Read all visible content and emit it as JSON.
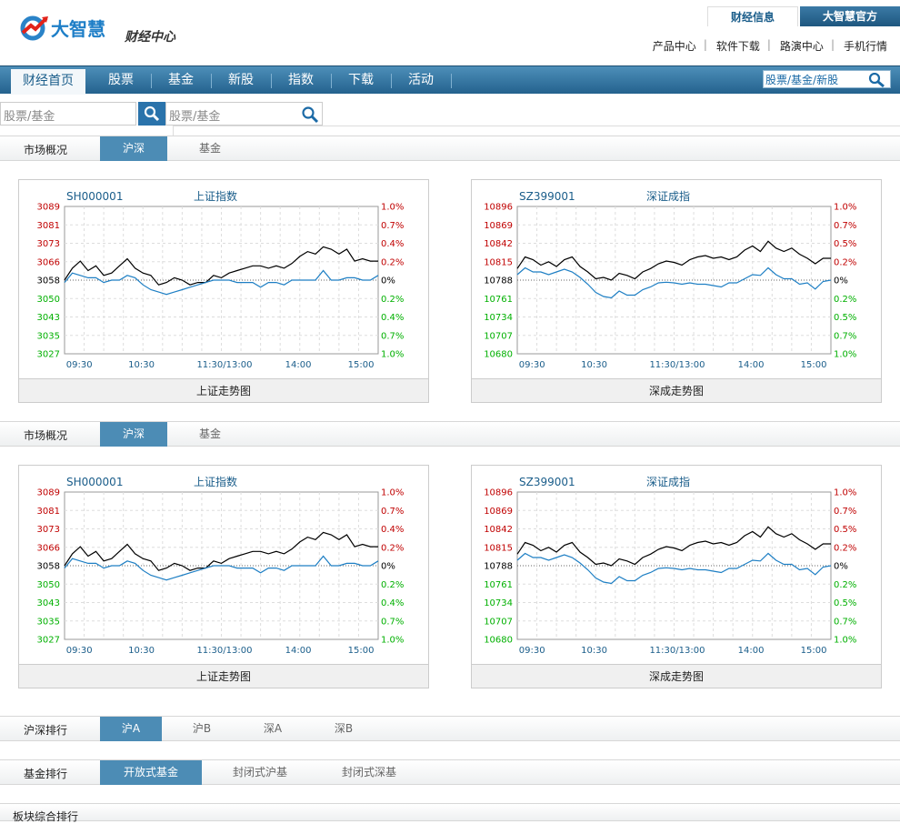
{
  "brand": {
    "name": "大智慧",
    "subtitle": "财经中心"
  },
  "top_tabs": [
    "财经信息",
    "大智慧官方"
  ],
  "top_links": [
    "产品中心",
    "软件下载",
    "路演中心",
    "手机行情"
  ],
  "nav": {
    "items": [
      "财经首页",
      "股票",
      "基金",
      "新股",
      "指数",
      "下载",
      "活动"
    ],
    "active": 0,
    "search_placeholder": "股票/基金/新股"
  },
  "search_row": {
    "input1": "股票/基金",
    "input2": "股票/基金"
  },
  "market_sections": [
    {
      "title": "市场概况",
      "tabs": [
        "沪深",
        "基金"
      ]
    },
    {
      "title": "市场概况",
      "tabs": [
        "沪深",
        "基金"
      ]
    }
  ],
  "chart_data": [
    {
      "type": "line",
      "title": "上证走势图",
      "code": "SH000001",
      "name": "上证指数",
      "x": [
        "09:30",
        "10:30",
        "11:30/13:00",
        "14:00",
        "15:00"
      ],
      "y_left": [
        3089,
        3081,
        3073,
        3066,
        3058,
        3050,
        3043,
        3035,
        3027
      ],
      "y_right": [
        "1.0%",
        "0.7%",
        "0.4%",
        "0.2%",
        "0%",
        "0.2%",
        "0.4%",
        "0.7%",
        "1.0%"
      ],
      "ylim": [
        3027,
        3089
      ],
      "prev_close": 3058,
      "series": [
        {
          "values": [
            3058,
            3063,
            3066,
            3062,
            3064,
            3060,
            3061,
            3064,
            3067,
            3063,
            3061,
            3060,
            3056,
            3057,
            3059,
            3058,
            3056,
            3057,
            3057,
            3060,
            3059,
            3061,
            3062,
            3063,
            3064,
            3064,
            3063,
            3064,
            3063,
            3065,
            3068,
            3070,
            3069,
            3072,
            3071,
            3069,
            3071,
            3066,
            3067,
            3066,
            3066
          ]
        },
        {
          "values": [
            3057,
            3061,
            3060,
            3059,
            3059,
            3057,
            3058,
            3058,
            3060,
            3059,
            3056,
            3054,
            3053,
            3052,
            3053,
            3054,
            3055,
            3056,
            3057,
            3058,
            3058,
            3058,
            3057,
            3057,
            3057,
            3055,
            3057,
            3057,
            3056,
            3058,
            3058,
            3058,
            3058,
            3062,
            3058,
            3058,
            3059,
            3059,
            3058,
            3058,
            3060
          ]
        }
      ]
    },
    {
      "type": "line",
      "title": "深成走势图",
      "code": "SZ399001",
      "name": "深证成指",
      "x": [
        "09:30",
        "10:30",
        "11:30/13:00",
        "14:00",
        "15:00"
      ],
      "y_left": [
        10896,
        10869,
        10842,
        10815,
        10788,
        10761,
        10734,
        10707,
        10680
      ],
      "y_right": [
        "1.0%",
        "0.7%",
        "0.5%",
        "0.2%",
        "0%",
        "0.2%",
        "0.5%",
        "0.7%",
        "1.0%"
      ],
      "ylim": [
        10680,
        10896
      ],
      "prev_close": 10788,
      "series": [
        {
          "values": [
            10805,
            10822,
            10818,
            10810,
            10815,
            10808,
            10818,
            10822,
            10808,
            10800,
            10790,
            10792,
            10788,
            10798,
            10795,
            10790,
            10800,
            10805,
            10812,
            10816,
            10814,
            10810,
            10818,
            10822,
            10824,
            10820,
            10822,
            10818,
            10822,
            10832,
            10838,
            10830,
            10845,
            10835,
            10830,
            10835,
            10826,
            10820,
            10812,
            10820,
            10820
          ]
        },
        {
          "values": [
            10796,
            10806,
            10800,
            10800,
            10796,
            10800,
            10804,
            10800,
            10792,
            10782,
            10770,
            10764,
            10762,
            10772,
            10766,
            10766,
            10774,
            10778,
            10784,
            10785,
            10784,
            10782,
            10784,
            10782,
            10782,
            10780,
            10778,
            10784,
            10784,
            10790,
            10796,
            10795,
            10806,
            10796,
            10790,
            10790,
            10782,
            10784,
            10775,
            10786,
            10788
          ]
        }
      ]
    }
  ],
  "colors": {
    "accent": "#2a73ab",
    "nav_bg": "#24628e",
    "up": "#c00000",
    "down": "#00b000",
    "price_line": "#000000",
    "avg_line": "#1e7fc4"
  },
  "ranking": {
    "title": "沪深排行",
    "tabs": [
      "沪A",
      "沪B",
      "深A",
      "深B"
    ]
  },
  "fund_ranking": {
    "title": "基金排行",
    "tabs": [
      "开放式基金",
      "封闭式沪基",
      "封闭式深基"
    ]
  },
  "sector_ranking": {
    "title": "板块综合排行"
  }
}
